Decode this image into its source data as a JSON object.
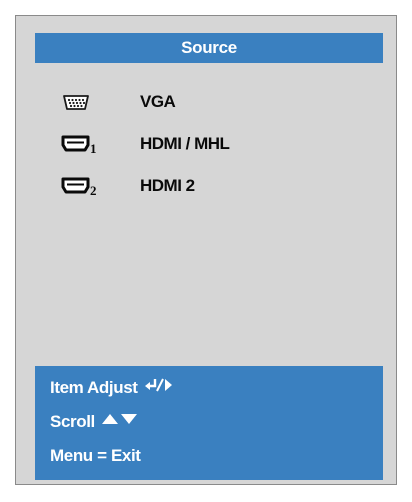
{
  "osd": {
    "title": "Source",
    "sources": [
      {
        "icon": "vga-port-icon",
        "label": "VGA",
        "selected": true
      },
      {
        "icon": "hdmi-1-icon",
        "label": "HDMI / MHL",
        "selected": false
      },
      {
        "icon": "hdmi-2-icon",
        "label": "HDMI 2",
        "selected": false
      }
    ],
    "help": {
      "item_adjust": "Item Adjust",
      "scroll": "Scroll",
      "menu_exit": "Menu = Exit"
    },
    "colors": {
      "accent": "#3a80c0",
      "panel": "#d6d6d6",
      "text": "#0a0a0a"
    }
  }
}
